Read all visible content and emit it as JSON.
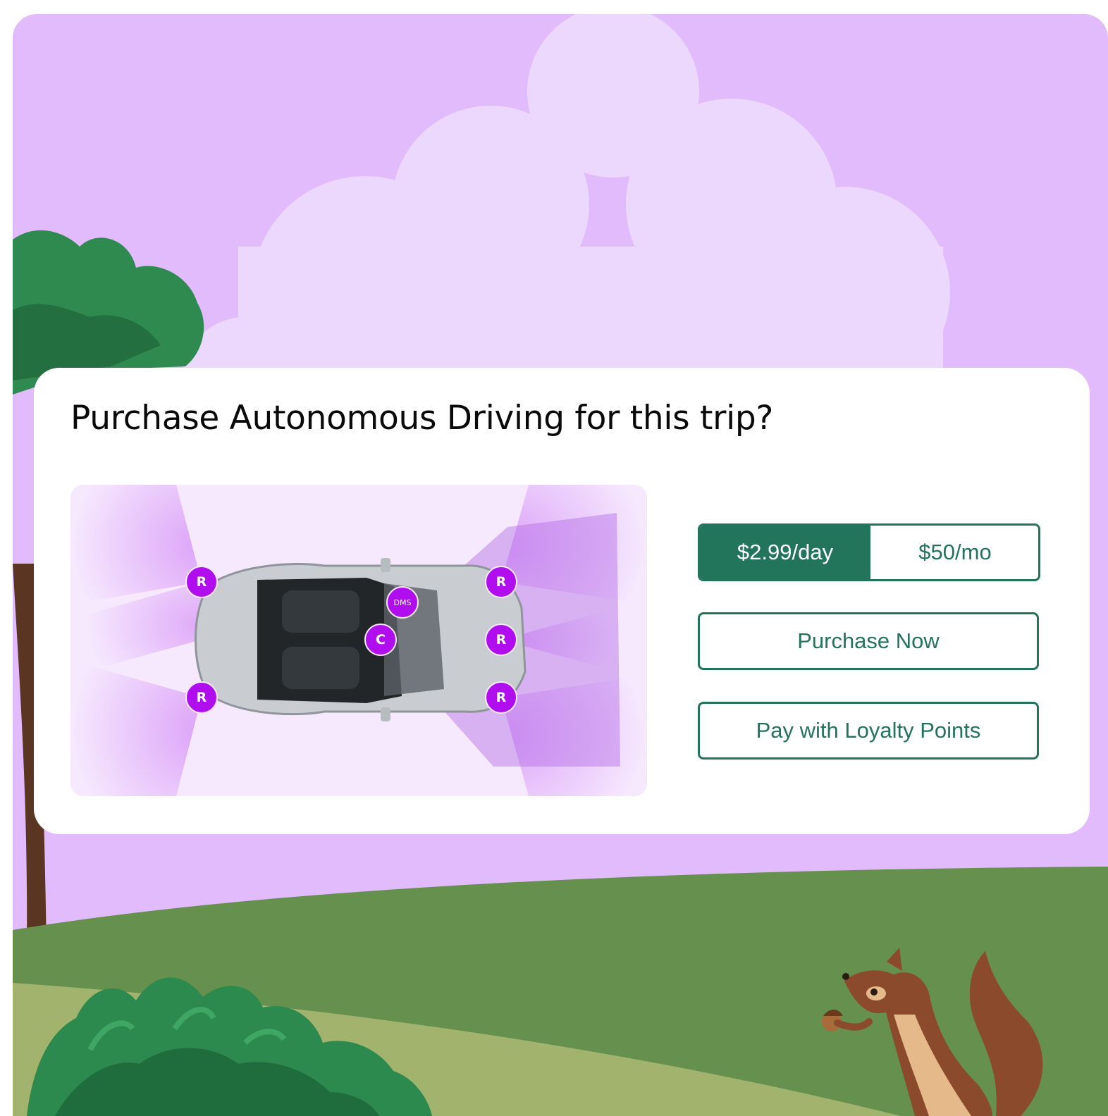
{
  "colors": {
    "sky": "#e1bbfb",
    "card_background": "#ffffff",
    "accent_green": "#22745a",
    "sensor_purple": "#b10ef0",
    "grass": "#65904e",
    "grass_light": "#a2b36d"
  },
  "dialog": {
    "title": "Purchase Autonomous Driving for this trip?"
  },
  "car_diagram": {
    "sensors": [
      {
        "label": "R"
      },
      {
        "label": "R"
      },
      {
        "label": "R"
      },
      {
        "label": "R"
      },
      {
        "label": "R"
      },
      {
        "label": "C"
      },
      {
        "label": "DMS"
      }
    ]
  },
  "pricing": {
    "options": [
      {
        "label": "$2.99/day",
        "selected": true
      },
      {
        "label": "$50/mo",
        "selected": false
      }
    ]
  },
  "actions": {
    "purchase_now": "Purchase Now",
    "loyalty": "Pay with Loyalty Points"
  },
  "scene_icons": [
    "cloud-icon",
    "tree-icon",
    "bush-icon",
    "squirrel-icon"
  ]
}
